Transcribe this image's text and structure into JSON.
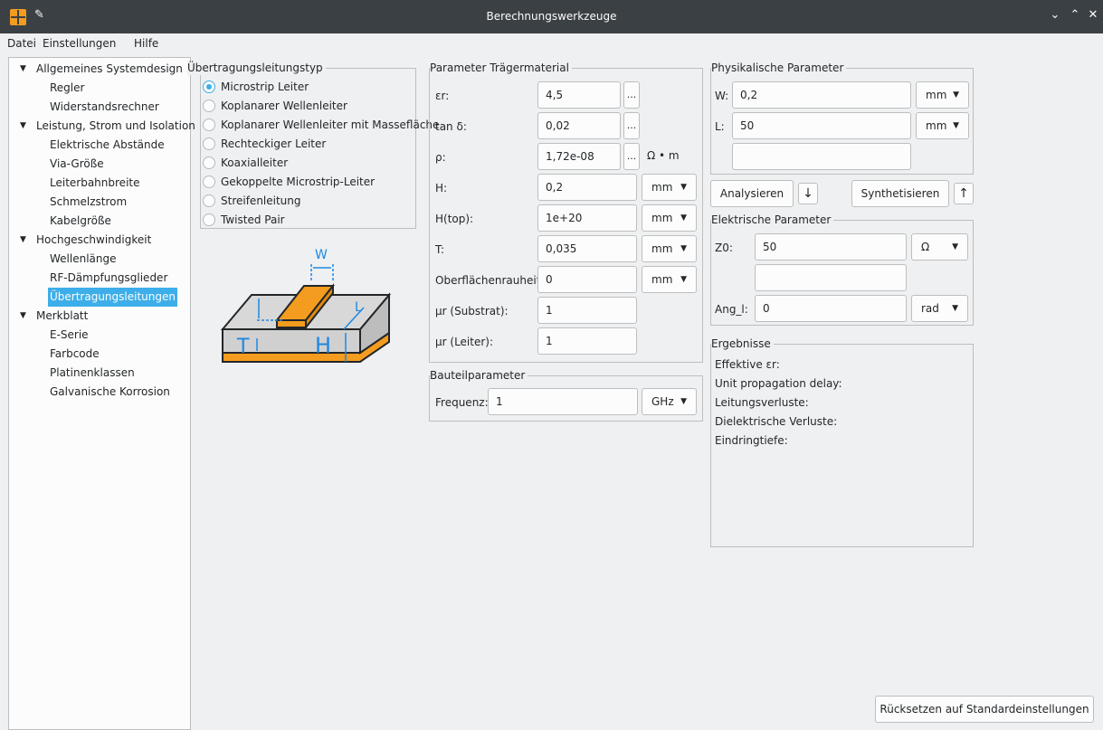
{
  "window": {
    "title": "Berechnungswerkzeuge",
    "controls": [
      "⌄",
      "⌃",
      "✕"
    ]
  },
  "menu": {
    "file": "Datei",
    "settings": "Einstellungen",
    "help": "Hilfe"
  },
  "tree": {
    "groups": [
      {
        "label": "Allgemeines Systemdesign",
        "items": [
          "Regler",
          "Widerstandsrechner"
        ]
      },
      {
        "label": "Leistung, Strom und Isolation",
        "items": [
          "Elektrische Abstände",
          "Via-Größe",
          "Leiterbahnbreite",
          "Schmelzstrom",
          "Kabelgröße"
        ]
      },
      {
        "label": "Hochgeschwindigkeit",
        "items": [
          "Wellenlänge",
          "RF-Dämpfungsglieder",
          "Übertragungsleitungen"
        ]
      },
      {
        "label": "Merkblatt",
        "items": [
          "E-Serie",
          "Farbcode",
          "Platinenklassen",
          "Galvanische Korrosion"
        ]
      }
    ],
    "selected": "Übertragungsleitungen"
  },
  "line_type": {
    "title": "Übertragungsleitungstyp",
    "options": [
      "Microstrip Leiter",
      "Koplanarer Wellenleiter",
      "Koplanarer Wellenleiter mit Massefläche",
      "Rechteckiger Leiter",
      "Koaxialleiter",
      "Gekoppelte Microstrip-Leiter",
      "Streifenleitung",
      "Twisted Pair"
    ],
    "selected_index": 0
  },
  "diagram": {
    "label_w": "W",
    "label_l": "L",
    "label_t": "T",
    "label_h": "H"
  },
  "substrate": {
    "title": "Parameter Trägermaterial",
    "rows": [
      {
        "label": "εr:",
        "value": "4,5",
        "dots": "..."
      },
      {
        "label": "tan δ:",
        "value": "0,02",
        "dots": "..."
      },
      {
        "label": "ρ:",
        "value": "1,72e-08",
        "dots": "...",
        "unit_text": "Ω • m"
      },
      {
        "label": "H:",
        "value": "0,2",
        "unit": "mm"
      },
      {
        "label": "H(top):",
        "value": "1e+20",
        "unit": "mm"
      },
      {
        "label": "T:",
        "value": "0,035",
        "unit": "mm"
      },
      {
        "label": "Oberflächenrauheit:",
        "value": "0",
        "unit": "mm"
      },
      {
        "label": "μr (Substrat):",
        "value": "1"
      },
      {
        "label": "μr (Leiter):",
        "value": "1"
      }
    ]
  },
  "component": {
    "title": "Bauteilparameter",
    "freq_label": "Frequenz:",
    "freq_value": "1",
    "freq_unit": "GHz"
  },
  "physical": {
    "title": "Physikalische Parameter",
    "w_label": "W:",
    "w_value": "0,2",
    "w_unit": "mm",
    "l_label": "L:",
    "l_value": "50",
    "l_unit": "mm",
    "extra_value": ""
  },
  "actions": {
    "analyze": "Analysieren",
    "analyze_arrow": "↓",
    "synthesize": "Synthetisieren",
    "synthesize_arrow": "↑"
  },
  "electrical": {
    "title": "Elektrische Parameter",
    "z0_label": "Z0:",
    "z0_value": "50",
    "z0_unit": "Ω",
    "extra_value": "",
    "ang_label": "Ang_l:",
    "ang_value": "0",
    "ang_unit": "rad"
  },
  "results": {
    "title": "Ergebnisse",
    "lines": [
      "Effektive εr:",
      "Unit propagation delay:",
      "Leitungsverluste:",
      "Dielektrische Verluste:",
      "Eindringtiefe:"
    ]
  },
  "reset_button": "Rücksetzen auf Standardeinstellungen",
  "icons": {
    "app": "calculator-app-icon",
    "pin": "pin-icon"
  },
  "colors": {
    "accent": "#3daee9",
    "titlebar": "#3b4045",
    "trace": "#f39c1f"
  }
}
